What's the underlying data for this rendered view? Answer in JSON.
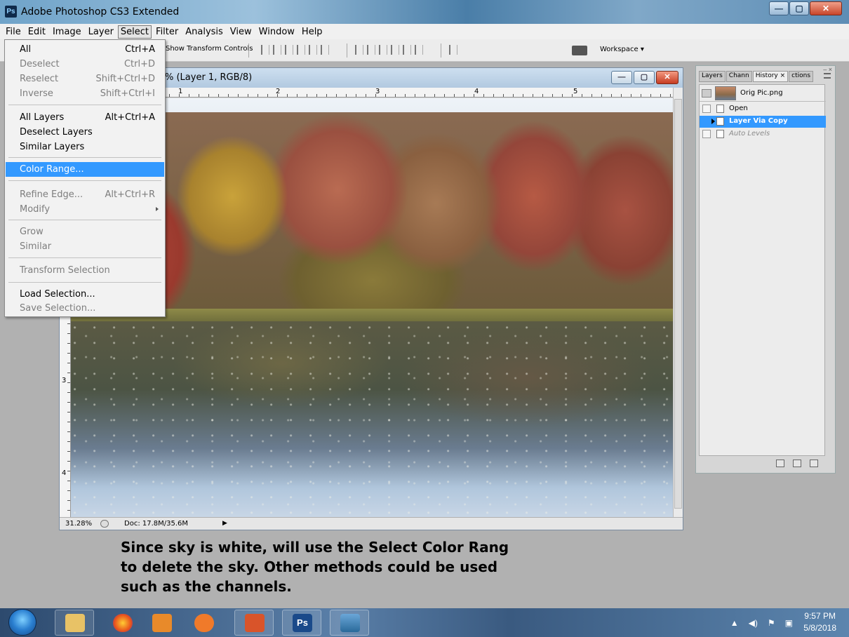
{
  "app": {
    "title": "Adobe Photoshop CS3 Extended",
    "icon_text": "Ps"
  },
  "menubar": [
    "File",
    "Edit",
    "Image",
    "Layer",
    "Select",
    "Filter",
    "Analysis",
    "View",
    "Window",
    "Help"
  ],
  "active_menu": "Select",
  "options_bar": {
    "show_transform": "Show Transform Controls",
    "workspace": "Workspace ▾"
  },
  "select_menu": [
    {
      "label": "All",
      "shortcut": "Ctrl+A",
      "enabled": true
    },
    {
      "label": "Deselect",
      "shortcut": "Ctrl+D",
      "enabled": false
    },
    {
      "label": "Reselect",
      "shortcut": "Shift+Ctrl+D",
      "enabled": false
    },
    {
      "label": "Inverse",
      "shortcut": "Shift+Ctrl+I",
      "enabled": false
    },
    {
      "label": "All Layers",
      "shortcut": "Alt+Ctrl+A",
      "enabled": true
    },
    {
      "label": "Deselect Layers",
      "shortcut": "",
      "enabled": true
    },
    {
      "label": "Similar Layers",
      "shortcut": "",
      "enabled": true
    },
    {
      "label": "Color Range...",
      "shortcut": "",
      "enabled": true,
      "highlighted": true
    },
    {
      "label": "Refine Edge...",
      "shortcut": "Alt+Ctrl+R",
      "enabled": false
    },
    {
      "label": "Modify",
      "shortcut": "",
      "enabled": false,
      "submenu": true
    },
    {
      "label": "Grow",
      "shortcut": "",
      "enabled": false
    },
    {
      "label": "Similar",
      "shortcut": "",
      "enabled": false
    },
    {
      "label": "Transform Selection",
      "shortcut": "",
      "enabled": false
    },
    {
      "label": "Load Selection...",
      "shortcut": "",
      "enabled": true
    },
    {
      "label": "Save Selection...",
      "shortcut": "",
      "enabled": false
    }
  ],
  "document": {
    "title": "% (Layer 1, RGB/8)",
    "zoom": "31.28%",
    "doc_size": "Doc: 17.8M/35.6M",
    "ruler_top": [
      "1",
      "2",
      "3",
      "4",
      "5"
    ],
    "ruler_left": [
      "3",
      "4"
    ]
  },
  "panel": {
    "tabs": [
      "Layers",
      "Chann",
      "History ×",
      "ctions"
    ],
    "active_tab": "History ×",
    "snapshot": "Orig Pic.png",
    "history": [
      {
        "label": "Open",
        "state": "normal"
      },
      {
        "label": "Layer Via Copy",
        "state": "selected"
      },
      {
        "label": "Auto Levels",
        "state": "undone"
      }
    ]
  },
  "caption": [
    "Since sky is white, will use the Select Color Rang",
    "to delete the sky.  Other methods could be used",
    "such as the channels."
  ],
  "taskbar": {
    "apps": [
      "explorer",
      "firefox",
      "media-player",
      "mail",
      "powerpoint",
      "photoshop",
      "photo-viewer"
    ],
    "clock_time": "9:57 PM",
    "clock_date": "5/8/2018"
  }
}
